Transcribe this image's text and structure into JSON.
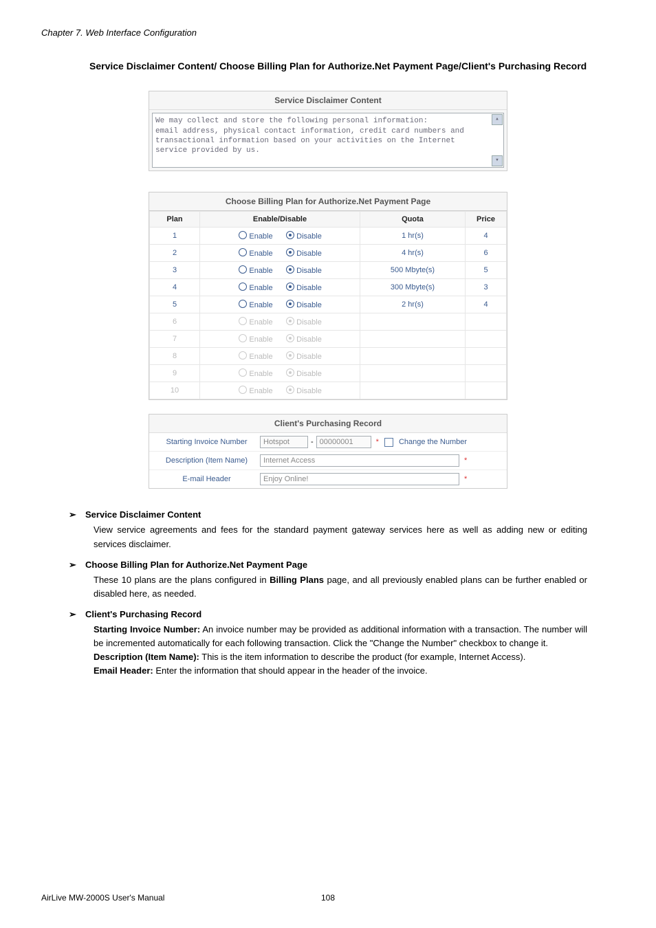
{
  "chapter": "Chapter 7.    Web Interface Configuration",
  "section_title": "Service Disclaimer Content/ Choose Billing Plan for Authorize.Net Payment Page/Client's Purchasing Record",
  "disclaimer": {
    "title": "Service Disclaimer Content",
    "text": "We may collect and store the following personal information:\nemail address, physical contact information, credit card numbers and transactional information based on your activities on the Internet service provided by us."
  },
  "plan_table": {
    "title": "Choose Billing Plan for Authorize.Net Payment Page",
    "headers": {
      "plan": "Plan",
      "ed": "Enable/Disable",
      "quota": "Quota",
      "price": "Price"
    },
    "opt_enable": "Enable",
    "opt_disable": "Disable",
    "rows": [
      {
        "plan": "1",
        "enabled": true,
        "quota": "1 hr(s)",
        "price": "4"
      },
      {
        "plan": "2",
        "enabled": true,
        "quota": "4 hr(s)",
        "price": "6"
      },
      {
        "plan": "3",
        "enabled": true,
        "quota": "500 Mbyte(s)",
        "price": "5"
      },
      {
        "plan": "4",
        "enabled": true,
        "quota": "300 Mbyte(s)",
        "price": "3"
      },
      {
        "plan": "5",
        "enabled": true,
        "quota": "2 hr(s)",
        "price": "4"
      },
      {
        "plan": "6",
        "enabled": false,
        "quota": "",
        "price": ""
      },
      {
        "plan": "7",
        "enabled": false,
        "quota": "",
        "price": ""
      },
      {
        "plan": "8",
        "enabled": false,
        "quota": "",
        "price": ""
      },
      {
        "plan": "9",
        "enabled": false,
        "quota": "",
        "price": ""
      },
      {
        "plan": "10",
        "enabled": false,
        "quota": "",
        "price": ""
      }
    ]
  },
  "purchasing": {
    "title": "Client's Purchasing Record",
    "rows": {
      "invoice": {
        "label": "Starting Invoice Number",
        "prefix": "Hotspot",
        "number": "00000001",
        "dash": "-",
        "star": "*",
        "change": "Change the Number"
      },
      "desc": {
        "label": "Description (Item Name)",
        "value": "Internet Access",
        "star": "*"
      },
      "email": {
        "label": "E-mail Header",
        "value": "Enjoy Online!",
        "star": "*"
      }
    }
  },
  "bullets": {
    "b1": {
      "title": "Service Disclaimer Content",
      "body": "View service agreements and fees for the standard payment gateway services here as well as adding new or editing services disclaimer."
    },
    "b2": {
      "title": "Choose Billing Plan for Authorize.Net Payment Page",
      "body_prefix": "These 10 plans are the plans configured in ",
      "body_bold": "Billing Plans",
      "body_suffix": " page, and all previously enabled plans can be further enabled or disabled here, as needed."
    },
    "b3": {
      "title": "Client's Purchasing Record",
      "p1_bold": "Starting Invoice Number:",
      "p1": " An invoice number may be provided as additional information with a transaction. The number will be incremented automatically for each following transaction. Click the \"Change the Number\" checkbox to change it.",
      "p2_bold": "Description (Item Name):",
      "p2": " This is the item information to describe the product (for example, Internet Access).",
      "p3_bold": "Email Header:",
      "p3": " Enter the information that should appear in the header of the invoice."
    }
  },
  "footer": {
    "left": "AirLive MW-2000S User's Manual",
    "page": "108"
  }
}
